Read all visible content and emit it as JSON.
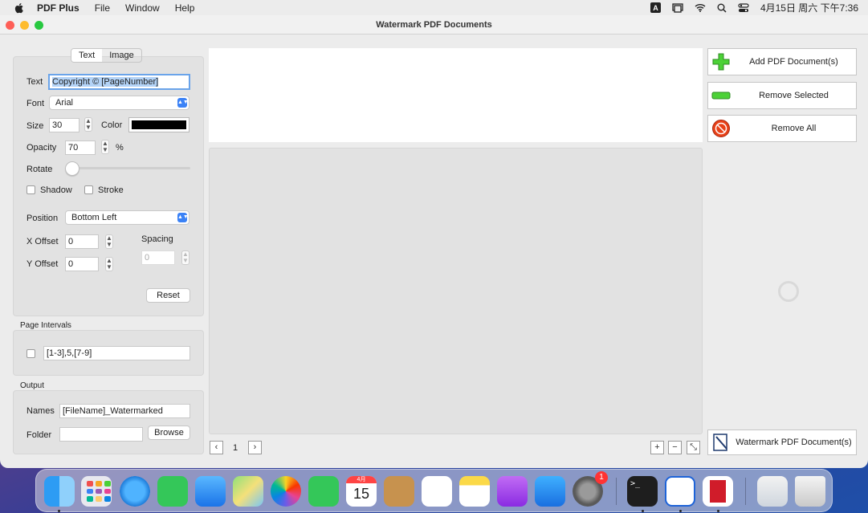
{
  "menubar": {
    "app_name": "PDF Plus",
    "items": [
      "File",
      "Window",
      "Help"
    ],
    "input_indicator": "A",
    "clock": "4月15日 周六 下午7:36"
  },
  "window": {
    "title": "Watermark PDF Documents"
  },
  "tabs": {
    "text": "Text",
    "image": "Image",
    "selected": "Text"
  },
  "text_settings": {
    "text_label": "Text",
    "text_value": "Copyright © [PageNumber]",
    "font_label": "Font",
    "font_value": "Arial",
    "size_label": "Size",
    "size_value": "30",
    "color_label": "Color",
    "color_value": "#000000",
    "opacity_label": "Opacity",
    "opacity_value": "70",
    "opacity_unit": "%",
    "rotate_label": "Rotate",
    "rotate_level": 0,
    "shadow_label": "Shadow",
    "stroke_label": "Stroke",
    "position_label": "Position",
    "position_value": "Bottom Left",
    "x_offset_label": "X Offset",
    "x_offset_value": "0",
    "y_offset_label": "Y Offset",
    "y_offset_value": "0",
    "spacing_label": "Spacing",
    "spacing_value": "0",
    "reset_label": "Reset"
  },
  "page_intervals": {
    "section_label": "Page Intervals",
    "value": "[1-3],5,[7-9]"
  },
  "output": {
    "section_label": "Output",
    "names_label": "Names",
    "names_value": "[FileName]_Watermarked",
    "folder_label": "Folder",
    "folder_value": "",
    "browse_label": "Browse"
  },
  "preview": {
    "page_number": "1"
  },
  "actions": {
    "add": "Add PDF Document(s)",
    "remove_selected": "Remove Selected",
    "remove_all": "Remove All",
    "watermark": "Watermark PDF Document(s)"
  },
  "dock": {
    "apps": [
      "Finder",
      "Launchpad",
      "Safari",
      "Messages",
      "Mail",
      "Maps",
      "Photos",
      "FaceTime",
      "Calendar",
      "Contacts",
      "Reminders",
      "Notes",
      "Podcasts",
      "App Store",
      "System Preferences",
      "Terminal",
      "PDF Plus Pro",
      "PDF Plus",
      "Downloads",
      "Trash"
    ],
    "calendar_month": "4月",
    "calendar_day": "15",
    "settings_badge": "1"
  },
  "colors": {
    "accent": "#3b82f6",
    "panel": "#e2e2e2",
    "window_bg": "#ececec"
  }
}
